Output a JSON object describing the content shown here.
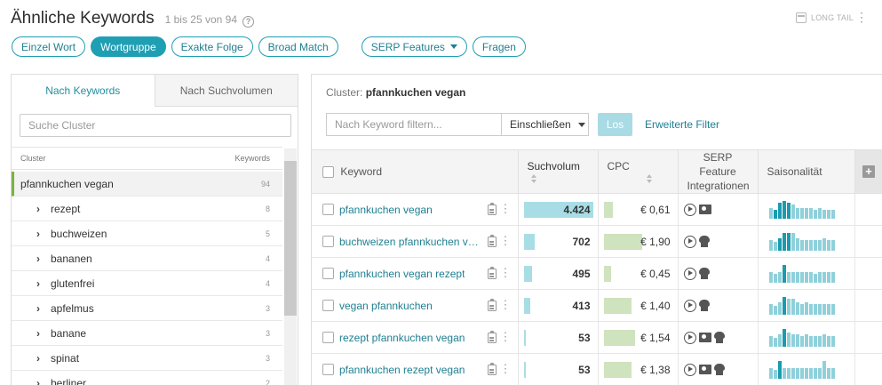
{
  "header": {
    "title": "Ähnliche Keywords",
    "counts": "1 bis 25 von 94",
    "help_icon": "?",
    "long_tail": "LONG TAIL",
    "kebab": "⋮"
  },
  "match_tabs": [
    {
      "label": "Einzel Wort",
      "active": false
    },
    {
      "label": "Wortgruppe",
      "active": true
    },
    {
      "label": "Exakte Folge",
      "active": false
    },
    {
      "label": "Broad Match",
      "active": false
    }
  ],
  "serp_features_label": "SERP Features",
  "questions_label": "Fragen",
  "left_panel": {
    "tabs": [
      {
        "label": "Nach Keywords",
        "active": true
      },
      {
        "label": "Nach Suchvolumen",
        "active": false
      }
    ],
    "search_placeholder": "Suche Cluster",
    "col_cluster": "Cluster",
    "col_keywords": "Keywords",
    "items": [
      {
        "label": "pfannkuchen vegan",
        "count": "94",
        "selected": true,
        "child": false
      },
      {
        "label": "rezept",
        "count": "8",
        "selected": false,
        "child": true
      },
      {
        "label": "buchweizen",
        "count": "5",
        "selected": false,
        "child": true
      },
      {
        "label": "bananen",
        "count": "4",
        "selected": false,
        "child": true
      },
      {
        "label": "glutenfrei",
        "count": "4",
        "selected": false,
        "child": true
      },
      {
        "label": "apfelmus",
        "count": "3",
        "selected": false,
        "child": true
      },
      {
        "label": "banane",
        "count": "3",
        "selected": false,
        "child": true
      },
      {
        "label": "spinat",
        "count": "3",
        "selected": false,
        "child": true
      },
      {
        "label": "berliner",
        "count": "2",
        "selected": false,
        "child": true
      }
    ]
  },
  "right_panel": {
    "cluster_label": "Cluster:",
    "cluster_value": "pfannkuchen vegan",
    "filter_placeholder": "Nach Keyword filtern...",
    "include_label": "Einschließen",
    "go_label": "Los",
    "advanced_label": "Erweiterte Filter",
    "columns": {
      "keyword": "Keyword",
      "volume": "Suchvolum",
      "cpc": "CPC",
      "serp_line1": "SERP Feature",
      "serp_line2": "Integrationen",
      "season": "Saisonalität",
      "add": "+"
    },
    "rows": [
      {
        "keyword": "pfannkuchen vegan",
        "volume": "4.424",
        "volume_share": 1.0,
        "cpc": "€ 0,61",
        "cpc_share": 0.22,
        "serp": [
          "video",
          "film"
        ],
        "season": [
          0.6,
          0.5,
          0.9,
          1.0,
          0.9,
          0.8,
          0.6,
          0.6,
          0.6,
          0.6,
          0.5,
          0.6,
          0.5,
          0.5,
          0.5
        ],
        "season_dark": [
          0,
          1,
          1,
          1,
          1
        ]
      },
      {
        "keyword": "buchweizen pfannkuchen vegan",
        "volume": "702",
        "volume_share": 0.16,
        "cpc": "€ 1,90",
        "cpc_share": 0.95,
        "serp": [
          "video",
          "chef"
        ],
        "season": [
          0.6,
          0.5,
          0.7,
          1.0,
          1.0,
          1.0,
          0.7,
          0.6,
          0.6,
          0.6,
          0.6,
          0.6,
          0.7,
          0.6,
          0.6
        ],
        "season_dark": [
          0,
          0,
          1,
          1,
          1
        ]
      },
      {
        "keyword": "pfannkuchen vegan rezept",
        "volume": "495",
        "volume_share": 0.11,
        "cpc": "€ 0,45",
        "cpc_share": 0.18,
        "serp": [
          "video",
          "chef"
        ],
        "season": [
          0.6,
          0.5,
          0.6,
          1.0,
          0.6,
          0.6,
          0.6,
          0.6,
          0.6,
          0.6,
          0.5,
          0.6,
          0.6,
          0.6,
          0.6
        ],
        "season_dark": [
          0,
          0,
          0,
          1,
          0
        ]
      },
      {
        "keyword": "vegan pfannkuchen",
        "volume": "413",
        "volume_share": 0.09,
        "cpc": "€ 1,40",
        "cpc_share": 0.7,
        "serp": [
          "video",
          "chef"
        ],
        "season": [
          0.6,
          0.5,
          0.7,
          1.0,
          0.9,
          0.9,
          0.7,
          0.6,
          0.7,
          0.6,
          0.6,
          0.6,
          0.6,
          0.6,
          0.6
        ],
        "season_dark": [
          0,
          0,
          0,
          1,
          0
        ]
      },
      {
        "keyword": "rezept pfannkuchen vegan",
        "volume": "53",
        "volume_share": 0.01,
        "cpc": "€ 1,54",
        "cpc_share": 0.77,
        "serp": [
          "video",
          "film",
          "chef"
        ],
        "season": [
          0.6,
          0.5,
          0.7,
          1.0,
          0.8,
          0.7,
          0.7,
          0.6,
          0.7,
          0.6,
          0.6,
          0.6,
          0.7,
          0.6,
          0.6
        ],
        "season_dark": [
          0,
          0,
          0,
          1,
          0
        ]
      },
      {
        "keyword": "pfannkuchen rezept vegan",
        "volume": "53",
        "volume_share": 0.01,
        "cpc": "€ 1,38",
        "cpc_share": 0.69,
        "serp": [
          "video",
          "film",
          "chef"
        ],
        "season": [
          0.6,
          0.5,
          1.0,
          0.6,
          0.6,
          0.6,
          0.6,
          0.6,
          0.6,
          0.6,
          0.6,
          0.6,
          1.0,
          0.6,
          0.6
        ],
        "season_dark": [
          0,
          0,
          1,
          0,
          0
        ]
      }
    ]
  },
  "colors": {
    "accent": "#1f9fb3",
    "volume_bar": "#a8dde6",
    "cpc_bar": "#cfe3bf",
    "season_light": "#8fd0db",
    "season_dark": "#1a9bb0",
    "selected_marker": "#7bb340"
  },
  "icons": {
    "help": "question-circle-icon",
    "long_tail": "calendar-icon",
    "clipboard": "clipboard-icon",
    "video": "play-circle-icon",
    "film": "film-icon",
    "chef": "chef-hat-icon"
  }
}
